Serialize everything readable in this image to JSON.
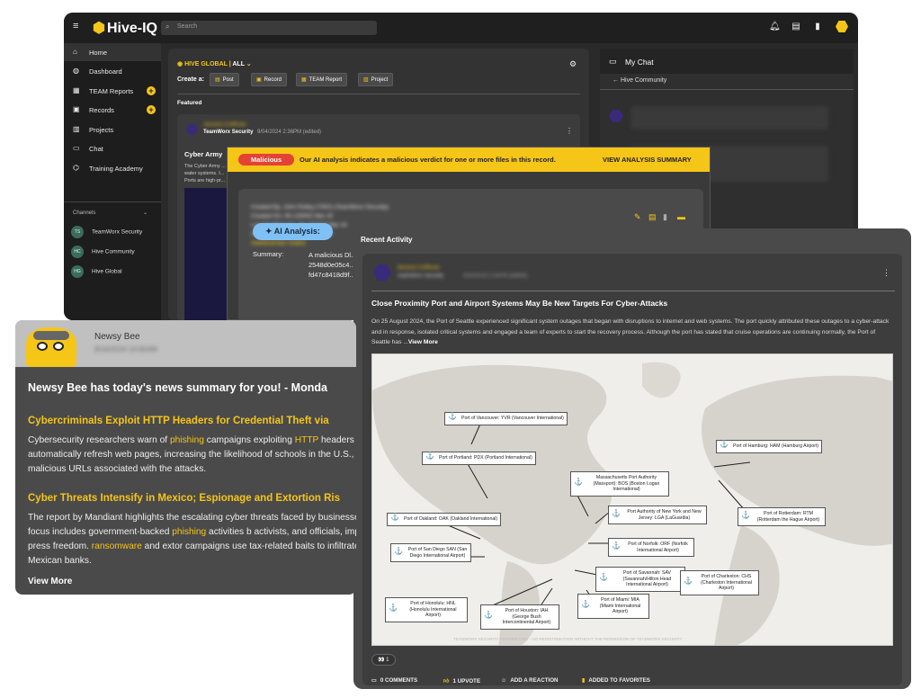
{
  "app": {
    "name": "Hive-IQ",
    "search_placeholder": "Search"
  },
  "sidebar": {
    "items": [
      {
        "label": "Home",
        "icon": "home-icon"
      },
      {
        "label": "Dashboard",
        "icon": "globe-icon"
      },
      {
        "label": "TEAM Reports",
        "icon": "newspaper-icon"
      },
      {
        "label": "Records",
        "icon": "records-icon"
      },
      {
        "label": "Projects",
        "icon": "projects-icon"
      },
      {
        "label": "Chat",
        "icon": "chat-icon"
      },
      {
        "label": "Training Academy",
        "icon": "graduation-cap-icon"
      }
    ],
    "channels_label": "Channels",
    "channels": [
      {
        "initials": "TS",
        "label": "TeamWorx Security"
      },
      {
        "initials": "HC",
        "label": "Hive Community"
      },
      {
        "initials": "HG",
        "label": "Hive Global"
      }
    ]
  },
  "feed": {
    "scope": "HIVE GLOBAL",
    "scope_filter": "ALL",
    "create_label": "Create a:",
    "create_buttons": [
      "Post",
      "Record",
      "TEAM Report",
      "Project"
    ],
    "featured_label": "Featured",
    "card": {
      "author": "Jessica Coffman",
      "org": "TeamWorx Security",
      "date": "9/04/2024 2:36PM (edited)",
      "title": "Cyber Army",
      "snippet": "The Cyber Army ... water systems. I... Ports are high-pr..."
    }
  },
  "chat": {
    "title": "My Chat",
    "channel": "Hive Community"
  },
  "alert": {
    "badge": "Malicious",
    "message": "Our AI analysis indicates a malicious verdict for one or more files in this record.",
    "action": "VIEW ANALYSIS SUMMARY",
    "created_by": "Created By: John Rolley (TWX) (TeamWorx Security)",
    "created_on": "Created On: 06 1259SZ Mar 24",
    "modified_on": "Last Modified On: 06 1300SZ Mar 24",
    "uuid": "UUID: b36bff38-5543-4a8a-be2",
    "tasks": "ASSOCIATED TASKS",
    "ai_label": "AI Analysis:",
    "summary_label": "Summary:",
    "summary_text": "A malicious Dl... 2548d0e05c4... fd47c8418d9f..."
  },
  "recent": {
    "header": "Recent Activity",
    "author": "Jessica Coffman",
    "org": "TeamWorx Security",
    "date": "9/30/2024 2:55PM (edited)",
    "title": "Close Proximity Port and Airport Systems May Be New Targets For Cyber-Attacks",
    "body": "On 25 August 2024, the Port of Seattle experienced significant system outages that began with disruptions to internet and web systems. The port quickly attributed these outages to a cyber-attack and in response, isolated critical systems and engaged a team of experts to start the recovery process. Although the port has stated that cruise operations are continuing normally, the Port of Seattle has ...",
    "view_more": "View More",
    "watermark": "TEAMWORX SECURITY PROPRIETARY - NO REDISTRIBUTION WITHOUT THE PERMISSION OF TEAMWORX SECURITY",
    "reaction_count": "1",
    "reaction_emoji": "👀",
    "footer": {
      "comments": "0 COMMENTS",
      "upvotes": "1 UPVOTE",
      "reaction": "ADD A REACTION",
      "favorites": "ADDED TO FAVORITES"
    },
    "ports": [
      "Port of Vancouver: YVR (Vancouver International)",
      "Port of Portland: PDX (Portland International)",
      "Massachusetts Port Authority (Massport): BOS (Boston Logan International)",
      "Port Authority of New York and New Jersey: LGA (LaGuardia)",
      "Port of Hamburg: HAM (Hamburg Airport)",
      "Port of Rotterdam: RTM (Rotterdam the Hague Airport)",
      "Port of Oakland: OAK (Oakland International)",
      "Port of San Diego SAN (San Diego International Airport)",
      "Port of Norfolk: ORF (Norfolk International Airport)",
      "Port of Savannah: SAV (Savannah/Hilton Head International Airport)",
      "Port of Charleston: CHS (Charleston International Airport)",
      "Port of Honolulu: HNL (Honolulu International Airport)",
      "Port of Houston: IAH (George Bush Intercontinental Airport)",
      "Port of Miami: MIA (Miami International Airport)"
    ]
  },
  "newsy": {
    "name": "Newsy Bee",
    "date": "9/16/2024 10:00AM",
    "headline": "Newsy Bee has today's news summary for you! - Monda",
    "stories": [
      {
        "title": "Cybercriminals Exploit HTTP Headers for Credential Theft via",
        "body_pre": "Cybersecurity researchers warn of ",
        "hl1": "phishing",
        "body_mid": " campaigns exploiting ",
        "hl2": "HTTP",
        "body_post": " headers to automatically refresh web pages, increasing the likelihood of schools in the U.S., with malicious URLs associated with the attacks."
      },
      {
        "title": "Cyber Threats Intensify in Mexico; Espionage and Extortion Ris",
        "body_pre": "The report by Mandiant highlights the escalating cyber threats faced by businesses. The focus includes government-backed ",
        "hl1": "phishing",
        "body_mid": " activities b activists, and officials, impacting press freedom. ",
        "hl2": "ransomware",
        "body_post": " and extor campaigns use tax-related baits to infiltrate Mexican banks."
      }
    ],
    "view_more": "View More"
  },
  "colors": {
    "accent": "#f5c518",
    "danger": "#e34234",
    "ai": "#7fc1f5"
  }
}
